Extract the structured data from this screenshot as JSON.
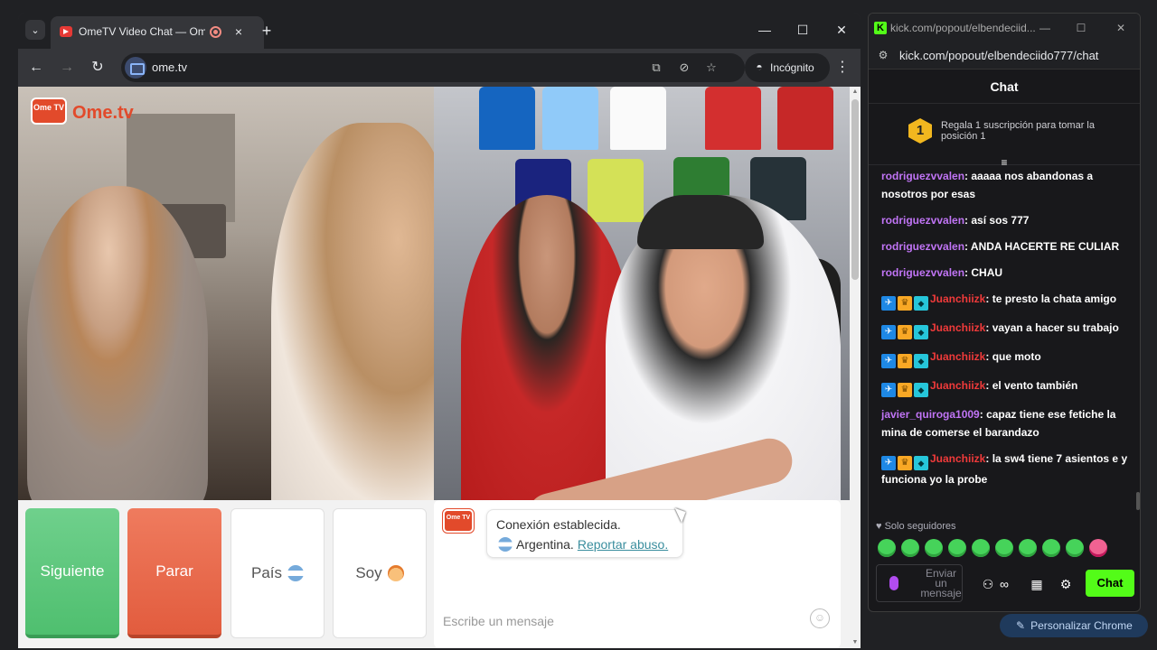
{
  "main_window": {
    "tab": {
      "title": "OmeTV Video Chat — Ome",
      "close": "×"
    },
    "new_tab": "+",
    "controls": {
      "minimize": "—",
      "maximize": "☐",
      "close": "✕"
    },
    "nav": {
      "back": "←",
      "forward": "→",
      "reload": "↻"
    },
    "url": "ome.tv",
    "incognito_label": "Incógnito",
    "menu": "⋮"
  },
  "page": {
    "logo_text": "Ome.tv",
    "logo_badge": "Ome TV",
    "buttons": {
      "next": "Siguiente",
      "stop": "Parar",
      "country": "País",
      "gender": "Soy"
    },
    "chat": {
      "status_line1": "Conexión establecida.",
      "country": "Argentina.",
      "report": "Reportar abuso.",
      "input_placeholder": "Escribe un mensaje"
    }
  },
  "kick": {
    "window_title": "kick.com/popout/elbendeciid...",
    "url": "kick.com/popout/elbendeciido777/chat",
    "chat_header": "Chat",
    "promo_rank": "1",
    "promo_text": "Regala 1 suscripción para tomar la posición 1",
    "messages": [
      {
        "user": "rodriguezvvalen",
        "text": "aaaaa nos abandonas a nosotros por esas",
        "badges": false
      },
      {
        "user": "rodriguezvvalen",
        "text": "así sos 777",
        "badges": false
      },
      {
        "user": "rodriguezvvalen",
        "text": "ANDA HACERTE RE CULIAR",
        "badges": false
      },
      {
        "user": "rodriguezvvalen",
        "text": "CHAU",
        "badges": false
      },
      {
        "user": "Juanchiizk",
        "text": "te presto la chata amigo",
        "badges": true
      },
      {
        "user": "Juanchiizk",
        "text": "vayan a hacer su trabajo",
        "badges": true
      },
      {
        "user": "Juanchiizk",
        "text": "que moto",
        "badges": true
      },
      {
        "user": "Juanchiizk",
        "text": "el vento también",
        "badges": true
      },
      {
        "user": "javier_quiroga1009",
        "text": "capaz tiene ese fetiche la mina de comerse el barandazo",
        "badges": false
      },
      {
        "user": "Juanchiizk",
        "text": "la sw4 tiene 7 asientos e y funciona yo la probe",
        "badges": true
      }
    ],
    "followers_only": "Solo seguidores",
    "input_placeholder": "Enviar un mensaje",
    "send_button": "Chat"
  },
  "personalize": "Personalizar Chrome",
  "colors": {
    "kick_green": "#53fc18",
    "ome_red": "#e24a2b",
    "next_green": "#4fbf6f",
    "stop_red": "#e25c3e"
  }
}
